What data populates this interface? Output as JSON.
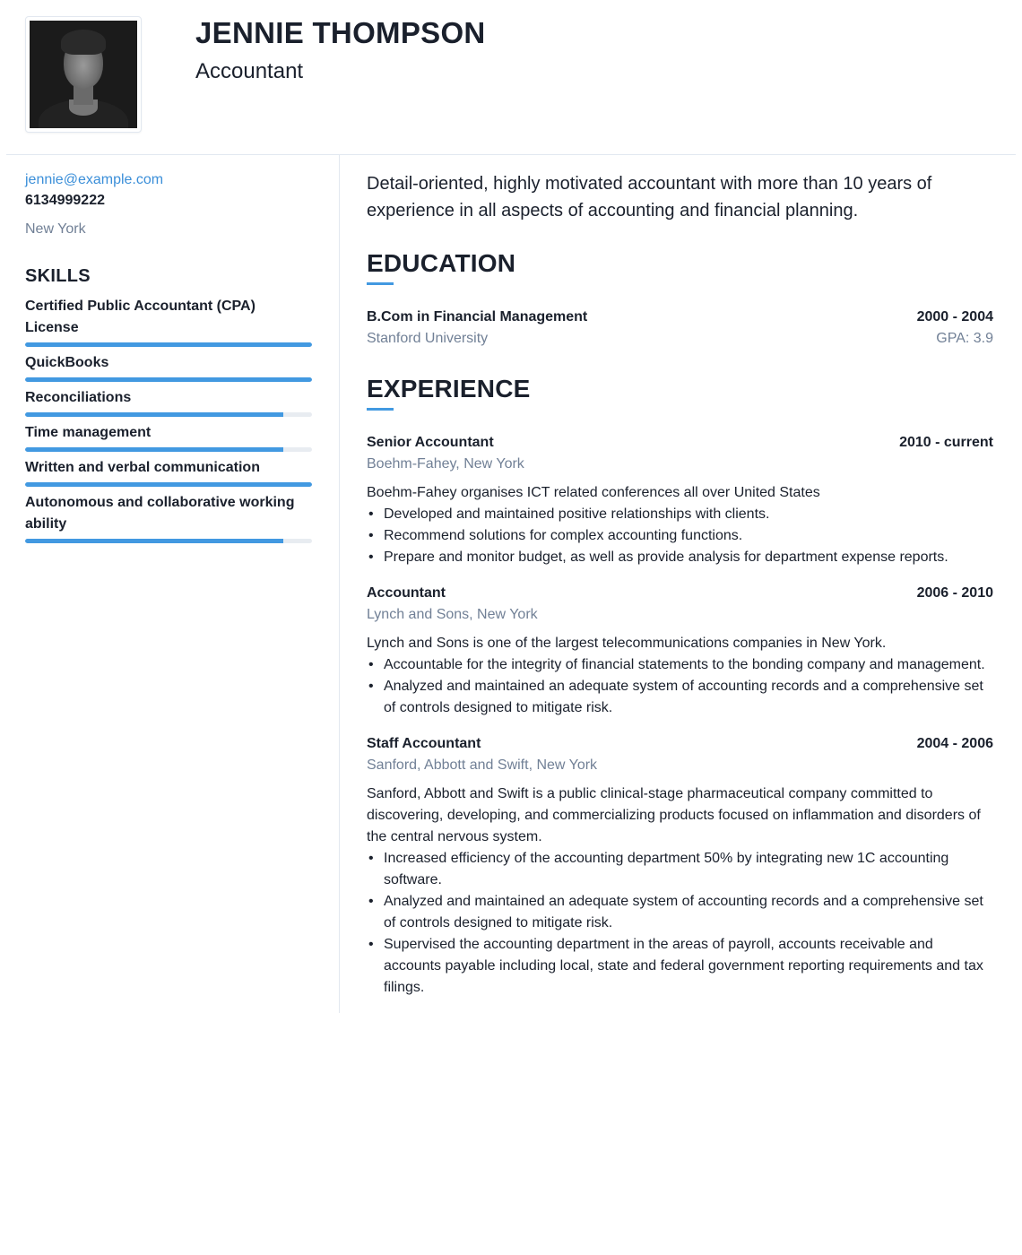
{
  "profile": {
    "name": "JENNIE THOMPSON",
    "title": "Accountant",
    "photo_alt": "Portrait photo of Jennie Thompson"
  },
  "contact": {
    "email": "jennie@example.com",
    "phone": "6134999222",
    "location": "New York"
  },
  "skills": {
    "heading": "SKILLS",
    "items": [
      {
        "name": "Certified Public Accountant (CPA) License",
        "level": 1.0
      },
      {
        "name": "QuickBooks",
        "level": 1.0
      },
      {
        "name": "Reconciliations",
        "level": 0.9
      },
      {
        "name": "Time management",
        "level": 0.9
      },
      {
        "name": "Written and verbal communication",
        "level": 1.0
      },
      {
        "name": "Autonomous and collaborative working ability",
        "level": 0.9
      }
    ]
  },
  "summary": "Detail-oriented, highly motivated accountant with more than 10 years of experience in all aspects of accounting and financial planning.",
  "education": {
    "heading": "EDUCATION",
    "items": [
      {
        "degree": "B.Com in Financial Management",
        "years": "2000 - 2004",
        "school": "Stanford University",
        "gpa": "GPA: 3.9"
      }
    ]
  },
  "experience": {
    "heading": "EXPERIENCE",
    "items": [
      {
        "role": "Senior Accountant",
        "years": "2010 - current",
        "company": "Boehm-Fahey, New York",
        "description": "Boehm-Fahey organises ICT related conferences all over United States",
        "bullets": [
          "Developed and maintained positive relationships with clients.",
          "Recommend solutions for complex accounting functions.",
          "Prepare and monitor budget, as well as provide analysis for department expense reports."
        ]
      },
      {
        "role": "Accountant",
        "years": "2006 - 2010",
        "company": "Lynch and Sons, New York",
        "description": "Lynch and Sons is one of the largest telecommunications companies in New York.",
        "bullets": [
          "Accountable for the integrity of financial statements to the bonding company and management.",
          "Analyzed and maintained an adequate system of accounting records and a comprehensive set of controls designed to mitigate risk."
        ]
      },
      {
        "role": "Staff Accountant",
        "years": "2004 - 2006",
        "company": "Sanford, Abbott and Swift, New York",
        "description": "Sanford, Abbott and Swift is a public clinical-stage pharmaceutical company committed to discovering, developing, and commercializing products focused on inflammation and disorders of the central nervous system.",
        "bullets": [
          "Increased efficiency of the accounting department 50% by integrating new 1C accounting software.",
          "Analyzed and maintained an adequate system of accounting records and a comprehensive set of controls designed to mitigate risk.",
          "Supervised the accounting department in the areas of payroll, accounts receivable and accounts payable including local, state and federal government reporting requirements and tax filings."
        ]
      }
    ]
  },
  "colors": {
    "accent": "#4299e1",
    "link": "#3b8fd9",
    "muted": "#718096",
    "text": "#1a202c",
    "divider": "#e2e8f0",
    "bar_track": "#e8ecf1"
  }
}
